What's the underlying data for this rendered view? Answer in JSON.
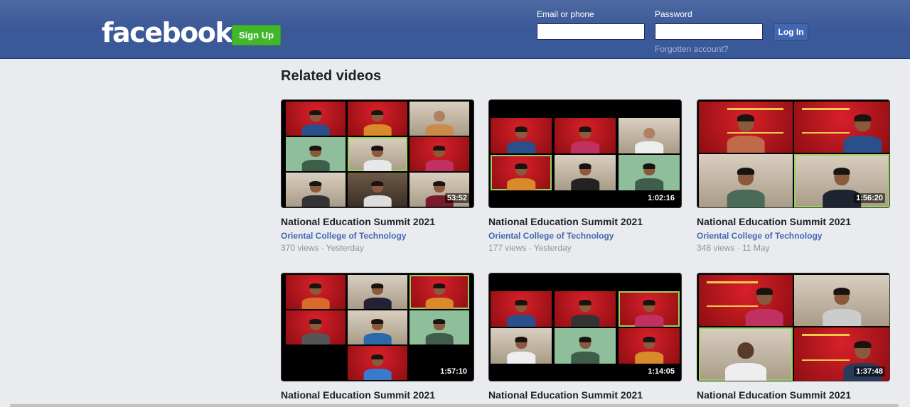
{
  "header": {
    "logo": "facebook",
    "signup_label": "Sign Up",
    "email_label": "Email or phone",
    "email_value": "",
    "password_label": "Password",
    "password_value": "",
    "login_label": "Log In",
    "forgot_label": "Forgotten account?"
  },
  "main": {
    "section_title": "Related videos",
    "videos": [
      {
        "title": "National Education Summit 2021",
        "channel": "Oriental College of Technology",
        "meta": "370 views · Yesterday",
        "duration": "53:52"
      },
      {
        "title": "National Education Summit 2021",
        "channel": "Oriental College of Technology",
        "meta": "177 views · Yesterday",
        "duration": "1:02:16"
      },
      {
        "title": "National Education Summit 2021",
        "channel": "Oriental College of Technology",
        "meta": "348 views · 11 May",
        "duration": "1:56:20"
      },
      {
        "title": "National Education Summit 2021",
        "duration": "1:57:10"
      },
      {
        "title": "National Education Summit 2021",
        "duration": "1:14:05"
      },
      {
        "title": "National Education Summit 2021",
        "duration": "1:37:48"
      }
    ]
  },
  "colors": {
    "header_bg": "#3b5998",
    "signup_green": "#42b72a",
    "link_blue": "#4267b2",
    "page_bg": "#e9ebee"
  }
}
